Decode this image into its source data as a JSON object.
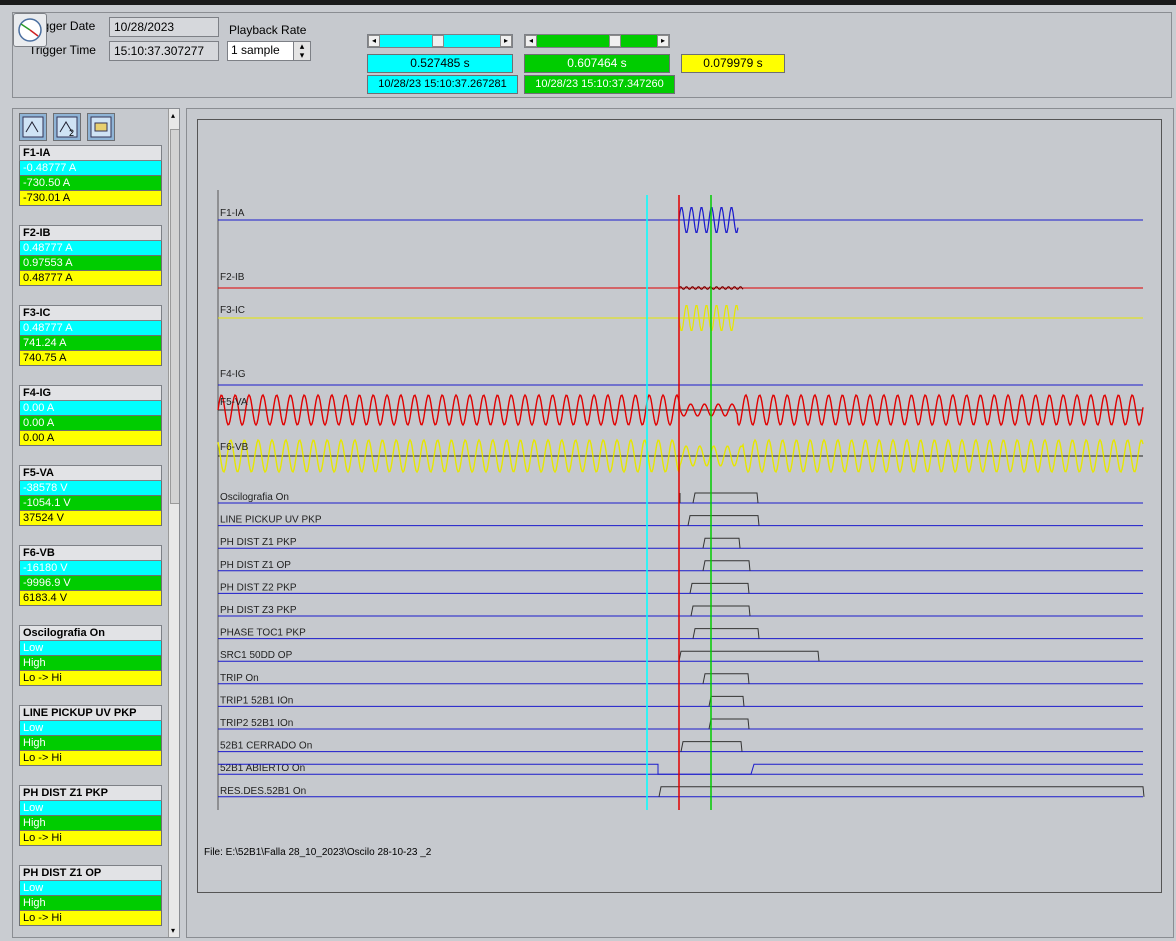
{
  "header": {
    "trigger_date_label": "Trigger Date",
    "trigger_date": "10/28/2023",
    "trigger_time_label": "Trigger Time",
    "trigger_time": "15:10:37.307277",
    "playback_rate_label": "Playback Rate",
    "playback_rate": "1 sample",
    "cursor1_time": "0.527485 s",
    "cursor1_timestamp": "10/28/23 15:10:37.267281",
    "cursor2_time": "0.607464 s",
    "cursor2_timestamp": "10/28/23 15:10:37.347260",
    "delta_time": "0.079979 s"
  },
  "colors": {
    "cyan": "#00ffff",
    "green": "#00cc00",
    "yellow": "#ffff00",
    "red": "#e00000",
    "blue": "#1a1acc"
  },
  "sidebar": {
    "tools": [
      "cursor1-icon",
      "cursor2-icon",
      "zoom-icon"
    ],
    "channels": [
      {
        "name": "F1-IA",
        "values": [
          "-0.48777 A",
          "-730.50 A",
          "-730.01 A"
        ]
      },
      {
        "name": "F2-IB",
        "values": [
          "0.48777 A",
          "0.97553 A",
          "0.48777 A"
        ]
      },
      {
        "name": "F3-IC",
        "values": [
          "0.48777 A",
          "741.24 A",
          "740.75 A"
        ]
      },
      {
        "name": "F4-IG",
        "values": [
          "0.00 A",
          "0.00 A",
          "0.00 A"
        ]
      },
      {
        "name": "F5-VA",
        "values": [
          "-38578 V",
          "-1054.1 V",
          "37524 V"
        ]
      },
      {
        "name": "F6-VB",
        "values": [
          "-16180 V",
          "-9996.9 V",
          "6183.4 V"
        ]
      },
      {
        "name": "Oscilografia On",
        "values": [
          "Low",
          "High",
          "Lo -> Hi"
        ]
      },
      {
        "name": "LINE PICKUP UV PKP",
        "values": [
          "Low",
          "High",
          "Lo -> Hi"
        ]
      },
      {
        "name": "PH DIST Z1 PKP",
        "values": [
          "Low",
          "High",
          "Lo -> Hi"
        ]
      },
      {
        "name": "PH DIST Z1 OP",
        "values": [
          "Low",
          "High",
          "Lo -> Hi"
        ]
      }
    ]
  },
  "plot": {
    "analog": [
      "F1-IA",
      "F2-IB",
      "F3-IC",
      "F4-IG",
      "F5-VA",
      "F6-VB"
    ],
    "digital": [
      "Oscilografia On",
      "LINE PICKUP UV PKP",
      "PH DIST Z1 PKP",
      "PH DIST Z1 OP",
      "PH DIST Z2 PKP",
      "PH DIST Z3 PKP",
      "PHASE TOC1 PKP",
      "SRC1 50DD OP",
      "TRIP      On",
      "TRIP1 52B1   IOn",
      "TRIP2 52B1   IOn",
      "52B1 CERRADO On",
      "52B1 ABIERTO On",
      "RES.DES.52B1 On"
    ],
    "file": "File: E:\\52B1\\Falla 28_10_2023\\Oscilo 28-10-23 _2"
  }
}
